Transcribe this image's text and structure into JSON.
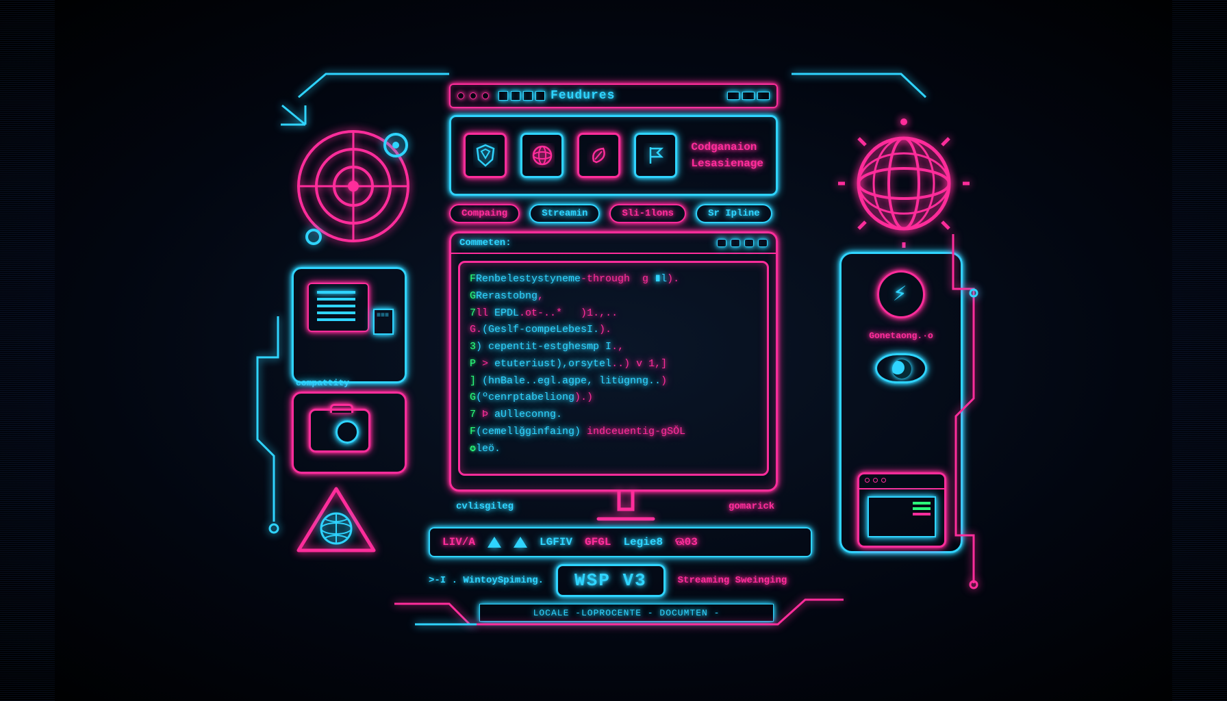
{
  "header": {
    "title": "Feudures"
  },
  "tileLabels": {
    "a": "Codganaion",
    "b": "Lesasienage"
  },
  "tabs": [
    "Compaing",
    "Streamin",
    "Sli-1lons",
    "Sr Ipline"
  ],
  "terminal": {
    "title": "Commeten:",
    "lines": [
      [
        [
          "g",
          "F"
        ],
        [
          "c",
          "Renbelestystyneme"
        ],
        [
          "p",
          "-through  g "
        ],
        [
          "c",
          "∎l"
        ],
        [
          "p",
          ")."
        ]
      ],
      [
        [
          "g",
          "G"
        ],
        [
          "c",
          "Rerastobng"
        ],
        [
          "p",
          ","
        ]
      ],
      [
        [
          "g",
          "7"
        ],
        [
          "p",
          "ll "
        ],
        [
          "c",
          "EPDL"
        ],
        [
          "p",
          ".ot-..*   )1.,.."
        ]
      ],
      [
        [
          "p",
          "G."
        ],
        [
          "c",
          "(Geslf-compeLebesI."
        ],
        [
          "p",
          ")."
        ]
      ],
      [
        [
          "g",
          "3"
        ],
        [
          "c",
          ") cepentit-estghesmp I"
        ],
        [
          "p",
          ".,"
        ]
      ],
      [
        [
          "g",
          "P"
        ],
        [
          "p",
          " > "
        ],
        [
          "c",
          "etuteriust),orsytel"
        ],
        [
          "p",
          "..) v 1,]"
        ]
      ],
      [
        [
          "g",
          "]"
        ],
        [
          "c",
          " (hnBale..egl.agpe, litügnng.."
        ],
        [
          "p",
          ")"
        ]
      ],
      [
        [
          "g",
          "G"
        ],
        [
          "c",
          "(ºcenrptabeliong"
        ],
        [
          "p",
          ").) "
        ]
      ],
      [
        [
          "g",
          "7"
        ],
        [
          "p",
          " Þ "
        ],
        [
          "c",
          "aUlleconng."
        ]
      ],
      [
        [
          "g",
          "F"
        ],
        [
          "c",
          "(cemellğginfaing) "
        ],
        [
          "p",
          "indceuentig-gSŎL"
        ]
      ],
      [
        [
          "g",
          "✪"
        ],
        [
          "c",
          "leö."
        ]
      ]
    ]
  },
  "floor": {
    "left": "cvlisgileg",
    "right": "gomarick"
  },
  "logos": [
    "LIV/A",
    "LGFIV",
    "GFGL",
    "Legie8",
    "ଊ03"
  ],
  "wsp": {
    "left": ">-I . WintoySpiming.",
    "badge": "WSP V3",
    "right": "Streaming Sweinging"
  },
  "footer": "LOCALE -LOPROCENTE - DOCUMTEN -",
  "compat": "compattity",
  "right": {
    "label": "Gonetaong.·o"
  }
}
